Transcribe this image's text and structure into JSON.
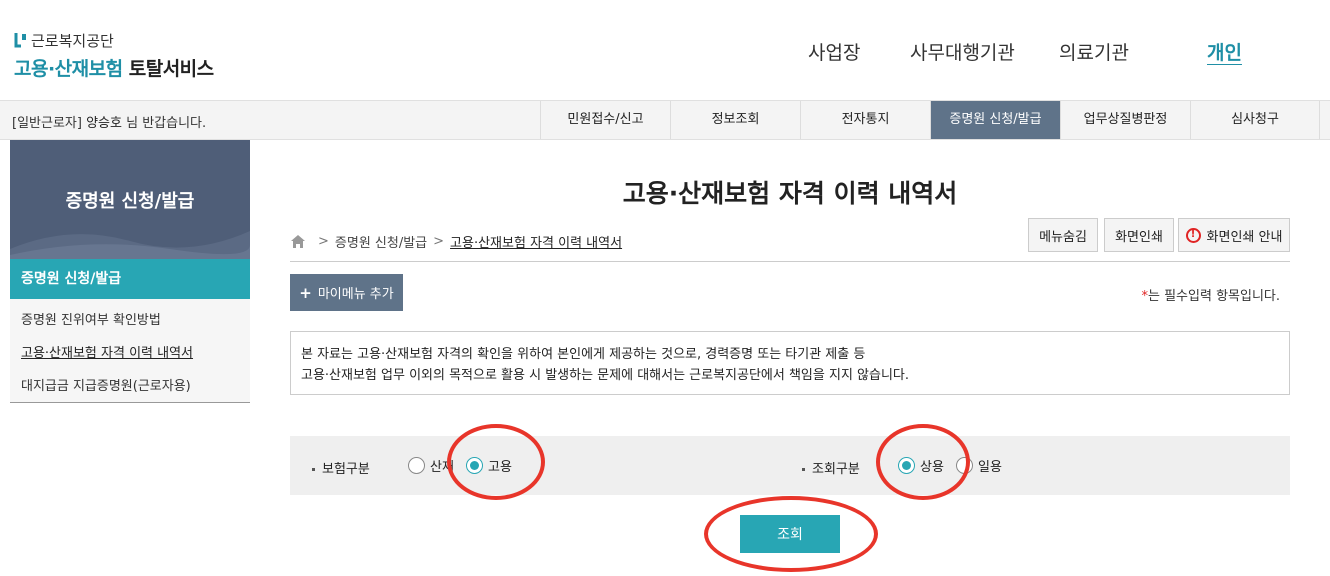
{
  "header": {
    "org_name": "근로복지공단",
    "service_name_part1": "고용·산재보험",
    "service_name_part2": "토탈서비스",
    "nav": [
      "사업장",
      "사무대행기관",
      "의료기관",
      "개인"
    ],
    "nav_active": "개인"
  },
  "subbar": {
    "welcome_prefix": "[일반근로자]",
    "user_name": "양승호",
    "welcome_suffix": "님 반갑습니다.",
    "menu": [
      "민원접수/신고",
      "정보조회",
      "전자통지",
      "증명원 신청/발급",
      "업무상질병판정",
      "심사청구"
    ],
    "menu_active": "증명원 신청/발급"
  },
  "sidebar": {
    "title": "증명원 신청/발급",
    "active_item": "증명원 신청/발급",
    "items": [
      "증명원 진위여부 확인방법",
      "고용·산재보험 자격 이력 내역서",
      "대지급금 지급증명원(근로자용)"
    ],
    "current_item": "고용·산재보험 자격 이력 내역서"
  },
  "main": {
    "title": "고용·산재보험 자격 이력 내역서",
    "breadcrumb": [
      "증명원 신청/발급",
      "고용·산재보험 자격 이력 내역서"
    ],
    "tools": {
      "hide_menu": "메뉴숨김",
      "print": "화면인쇄",
      "print_guide": "화면인쇄 안내"
    },
    "mymenu_label": "마이메뉴 추가",
    "required_note": "는 필수입력 항목입니다.",
    "required_star": "*",
    "notice_line1": "본 자료는 고용·산재보험 자격의 확인을 위하여 본인에게 제공하는 것으로, 경력증명 또는 타기관 제출 등",
    "notice_line2": "고용·산재보험 업무 이외의 목적으로 활용 시 발생하는 문제에 대해서는 근로복지공단에서 책임을 지지 않습니다.",
    "filters": {
      "insurance_label": "보험구분",
      "insurance_options": [
        "산재",
        "고용"
      ],
      "insurance_selected": "고용",
      "query_label": "조회구분",
      "query_options": [
        "상용",
        "일용"
      ],
      "query_selected": "상용"
    },
    "search_button": "조회"
  },
  "colors": {
    "teal": "#28a6b4",
    "slate": "#5f7389",
    "sidebar_head": "#4f5e78",
    "annotation_red": "#e8352a"
  }
}
